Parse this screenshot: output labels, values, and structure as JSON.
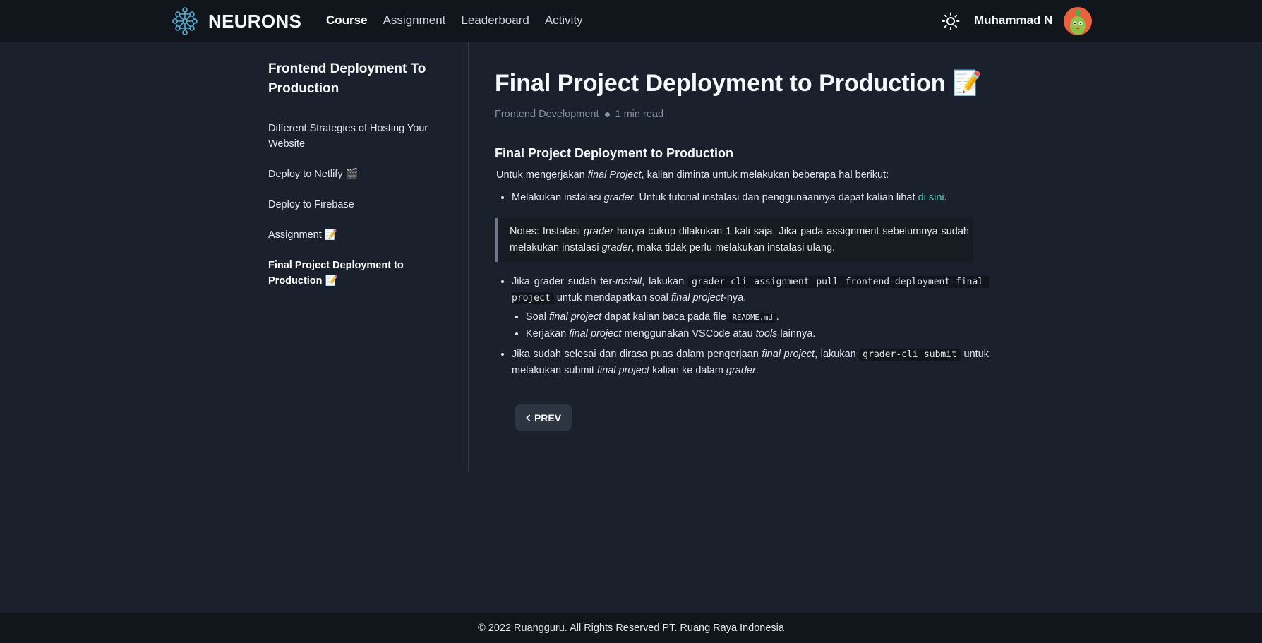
{
  "header": {
    "brand": "NEURONS",
    "nav": [
      "Course",
      "Assignment",
      "Leaderboard",
      "Activity"
    ],
    "active_nav": "Course",
    "user_name": "Muhammad N"
  },
  "sidebar": {
    "title": "Frontend Deployment To Production",
    "items": [
      {
        "label": "Different Strategies of Hosting Your Website"
      },
      {
        "label": "Deploy to Netlify 🎬"
      },
      {
        "label": "Deploy to Firebase"
      },
      {
        "label": "Assignment 📝"
      },
      {
        "label": "Final Project Deployment to Production 📝"
      }
    ]
  },
  "main": {
    "title": "Final Project Deployment to Production 📝",
    "category": "Frontend Development",
    "read_time": "1 min read",
    "section_title": "Final Project Deployment to Production",
    "intro_a": "Untuk mengerjakan ",
    "intro_em": "final Project",
    "intro_b": ", kalian diminta untuk melakukan beberapa hal berikut:",
    "b1_a": "Melakukan instalasi ",
    "b1_em": "grader",
    "b1_b": ". Untuk tutorial instalasi dan penggunaannya dapat kalian lihat ",
    "b1_link": "di sini",
    "b1_c": ".",
    "note_a": "Notes: Instalasi ",
    "note_em1": "grader",
    "note_b": " hanya cukup dilakukan 1 kali saja. Jika pada assignment sebelumnya sudah melakukan instalasi ",
    "note_em2": "grader",
    "note_c": ", maka tidak perlu melakukan instalasi ulang.",
    "b2_a": "Jika grader sudah ter-",
    "b2_em1": "install",
    "b2_b": ", lakukan ",
    "b2_code": "grader-cli assignment pull frontend-deployment-final-project",
    "b2_c": " untuk mendapatkan soal ",
    "b2_em2": "final project",
    "b2_d": "-nya.",
    "s1_a": "Soal ",
    "s1_em": "final project",
    "s1_b": " dapat kalian baca pada file ",
    "s1_code": "README.md",
    "s1_c": ".",
    "s2_a": "Kerjakan ",
    "s2_em1": "final project",
    "s2_b": " menggunakan VSCode atau ",
    "s2_em2": "tools",
    "s2_c": " lainnya.",
    "b3_a": "Jika sudah selesai dan dirasa puas dalam pengerjaan ",
    "b3_em1": "final project",
    "b3_b": ", lakukan ",
    "b3_code": "grader-cli submit",
    "b3_c": " untuk melakukan submit ",
    "b3_em2": "final project",
    "b3_d": " kalian ke dalam ",
    "b3_em3": "grader",
    "b3_e": ".",
    "prev_label": "PREV"
  },
  "footer": {
    "text": "© 2022 Ruangguru. All Rights Reserved PT. Ruang Raya Indonesia"
  },
  "colors": {
    "background": "#1a202c",
    "header": "#11151c",
    "link": "#4fd1c5",
    "avatar": "#e8623a",
    "logo": "#4fb3d9"
  },
  "icons": {
    "brand": "neural-network-logo-icon",
    "theme": "sun-icon",
    "prev": "chevron-left-icon"
  }
}
